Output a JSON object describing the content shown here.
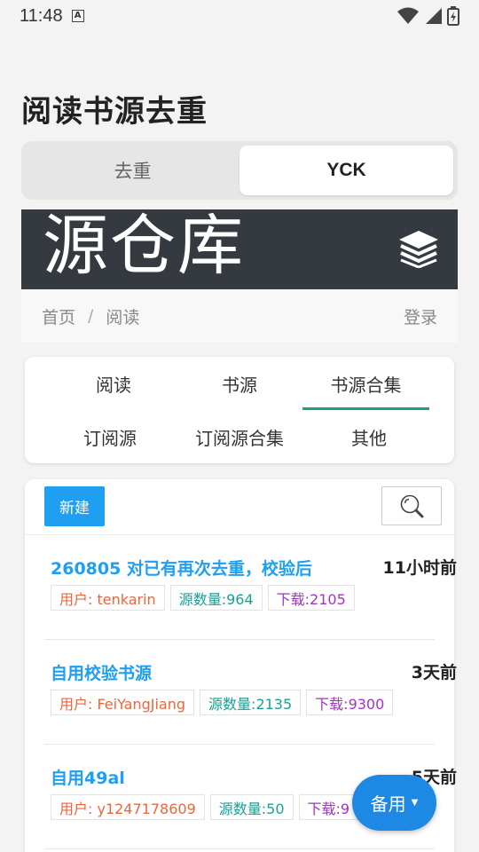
{
  "status": {
    "time": "11:48",
    "a_badge": "A"
  },
  "page": {
    "title": "阅读书源去重"
  },
  "segments": [
    {
      "label": "去重"
    },
    {
      "label": "YCK"
    }
  ],
  "banner": {
    "brand": "源仓库"
  },
  "breadcrumb": {
    "home": "首页",
    "separator": "/",
    "current": "阅读",
    "login": "登录"
  },
  "categories": [
    {
      "label": "阅读"
    },
    {
      "label": "书源"
    },
    {
      "label": "书源合集"
    },
    {
      "label": "订阅源"
    },
    {
      "label": "订阅源合集"
    },
    {
      "label": "其他"
    }
  ],
  "toolbar": {
    "new_label": "新建"
  },
  "items": [
    {
      "title": "260805 对已有再次去重，校验后",
      "time": "11小时前",
      "user": "用户: tenkarin",
      "count": "源数量:964",
      "downloads": "下载:2105"
    },
    {
      "title": "自用校验书源",
      "time": "3天前",
      "user": "用户: FeiYangJiang",
      "count": "源数量:2135",
      "downloads": "下载:9300"
    },
    {
      "title": "自用49al",
      "time": "5天前",
      "user": "用户: y1247178609",
      "count": "源数量:50",
      "downloads": "下载:9"
    }
  ],
  "fab": {
    "label": "备用",
    "caret": "▼"
  },
  "colors": {
    "accent": "#1e9ff2",
    "tab_underline": "#1aa084",
    "banner_bg": "#343a40"
  }
}
